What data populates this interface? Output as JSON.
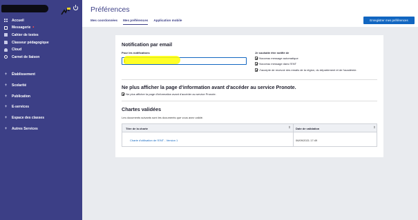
{
  "sidebar": {
    "items": [
      {
        "label": "Accueil",
        "icon": "grid-icon"
      },
      {
        "label": "Messagerie",
        "icon": "envelope-icon",
        "badge": "•"
      },
      {
        "label": "Cahier de textes",
        "icon": "book-icon"
      },
      {
        "label": "Classeur pédagogique",
        "icon": "folder-icon"
      },
      {
        "label": "Cloud",
        "icon": "cloud-icon"
      },
      {
        "label": "Carnet de liaison",
        "icon": "clock-icon"
      }
    ],
    "sections": [
      {
        "label": "Établissement"
      },
      {
        "label": "Scolarité"
      },
      {
        "label": "Publication"
      },
      {
        "label": "E-services"
      },
      {
        "label": "Espace des classes"
      },
      {
        "label": "Autres Services"
      }
    ],
    "plus_glyph": "+"
  },
  "header": {
    "title": "Préférences",
    "tabs": [
      {
        "label": "Mes coordonnées",
        "active": false
      },
      {
        "label": "Mes préférences",
        "active": true
      },
      {
        "label": "Application mobile",
        "active": false
      }
    ],
    "save_label": "Enregistrer mes préférences"
  },
  "notification": {
    "heading": "Notification par email",
    "email_label": "Pour les notifications",
    "email_value": "",
    "notify_label": "Je souhaite être notifié de",
    "options": [
      {
        "label": "Nouveau message automatique",
        "checked": true
      },
      {
        "label": "Nouveau message dans l'ENT",
        "checked": true
      },
      {
        "label": "J'accepte de recevoir des emails de la région, du département et de l'académie.",
        "checked": true
      }
    ]
  },
  "pronote": {
    "heading": "Ne plus afficher la page d'information avant d'accéder au service Pronote.",
    "option": {
      "label": "Ne plus afficher la page d'information avant d'accéder au service Pronote.",
      "checked": true
    }
  },
  "chartes": {
    "heading": "Chartes validées",
    "description": "Les documents suivants sont les documents que vous avez validé.",
    "columns": [
      "Titre de la charte",
      "Date de validation"
    ],
    "sort_glyph": "⇕",
    "rows": [
      {
        "title": "Charte d'utilisation de l'ENT - Version 1",
        "date": "06/09/2021 17:49"
      }
    ]
  },
  "colors": {
    "sidebar": "#3c3f86",
    "accent": "#1166c1",
    "highlight": "#ffff00",
    "background": "#e9ebef"
  }
}
